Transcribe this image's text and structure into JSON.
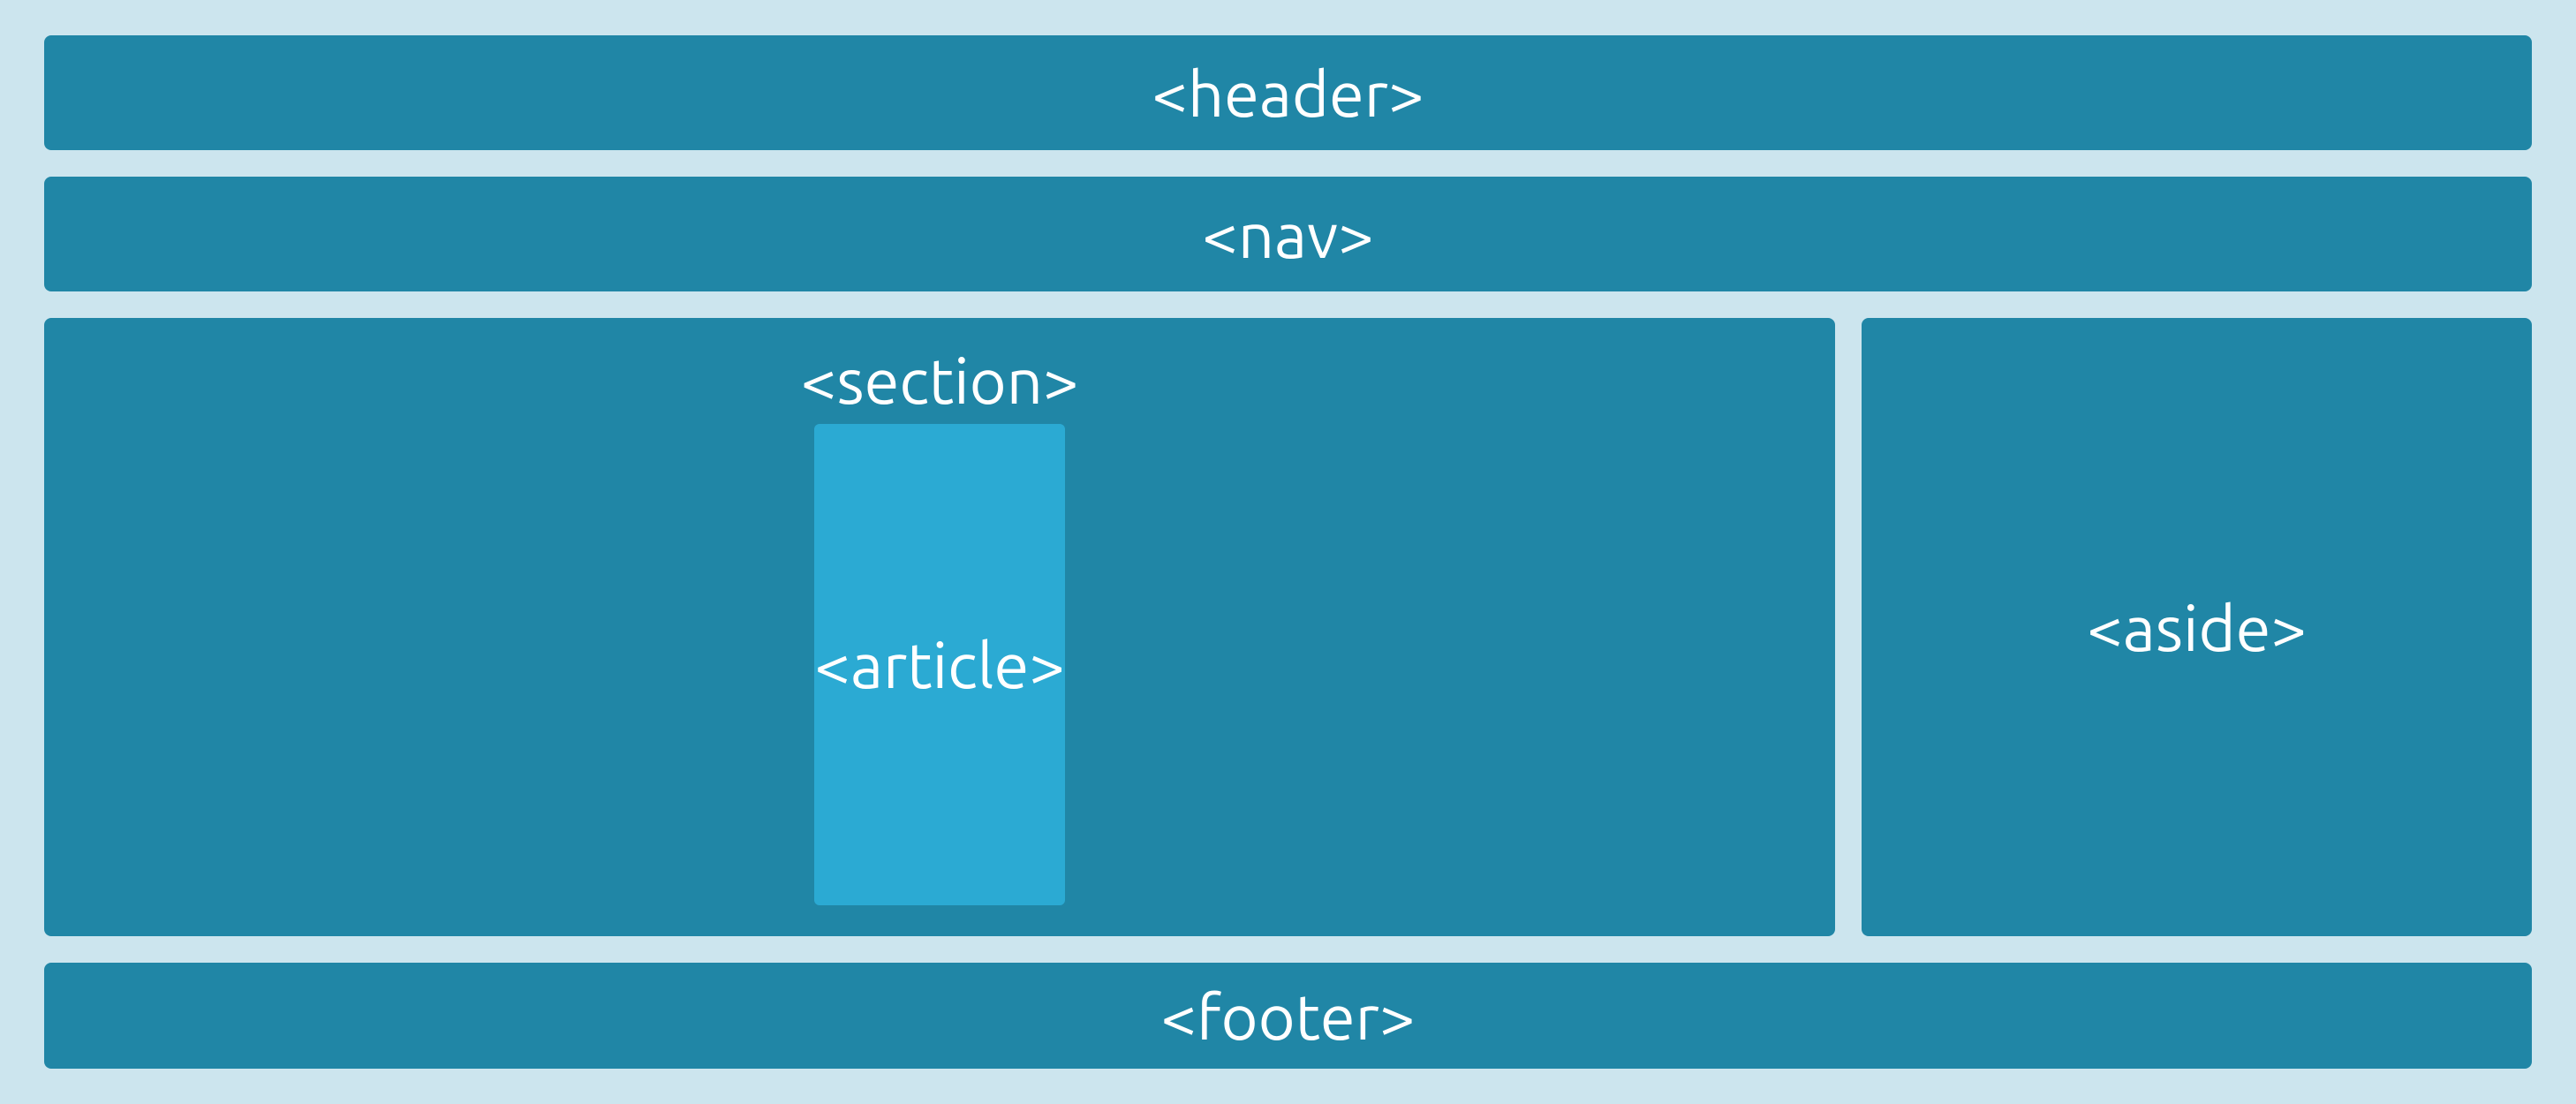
{
  "layout": {
    "header": "<header>",
    "nav": "<nav>",
    "section": "<section>",
    "article": "<article>",
    "aside": "<aside>",
    "footer": "<footer>"
  },
  "colors": {
    "background": "#cce5ee",
    "box_primary": "#2086a6",
    "box_nested": "#2baad3",
    "text": "#ffffff"
  }
}
